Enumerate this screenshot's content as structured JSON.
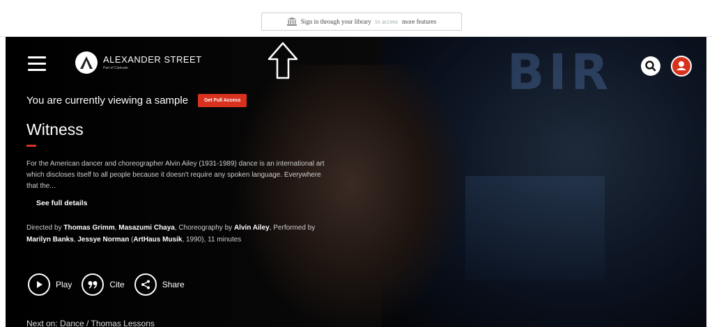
{
  "library_bar": {
    "signin_part1": "Sign in through your library",
    "signin_part2": "to access",
    "signin_part3": "more features",
    "icon": "bank-icon"
  },
  "header": {
    "brand": "ALEXANDER STREET",
    "brand_sub": "Part of Clarivate",
    "menu_icon": "hamburger-menu-icon",
    "search_icon": "search-icon",
    "user_icon": "user-icon"
  },
  "sample": {
    "notice": "You are currently viewing a sample",
    "cta": "Get Full Access"
  },
  "video": {
    "title": "Witness",
    "description": "For the American dancer and choreographer Alvin Ailey (1931-1989) dance is an international art which discloses itself to all people because it doesn't require any spoken language. Everywhere that the...",
    "see_details": "See full details",
    "credits": {
      "directed_prefix": "Directed by ",
      "director1": "Thomas Grimm",
      "sep1": ", ",
      "director2": "Masazumi Chaya",
      "choreo_prefix": ", Choreography by ",
      "choreographer": "Alvin Ailey",
      "performed_prefix": ", Performed by ",
      "performer1": "Marilyn Banks",
      "sep2": ", ",
      "performer2": "Jessye Norman",
      "publisher_open": " (",
      "publisher": "ArtHaus Musik",
      "publisher_close": ", 1990), 11 minutes"
    }
  },
  "actions": {
    "play": "Play",
    "cite": "Cite",
    "share": "Share"
  },
  "bottom": {
    "peek_text": "Next on: Dance / Thomas Lessons"
  },
  "colors": {
    "accent": "#d8321f",
    "background": "#050505"
  }
}
